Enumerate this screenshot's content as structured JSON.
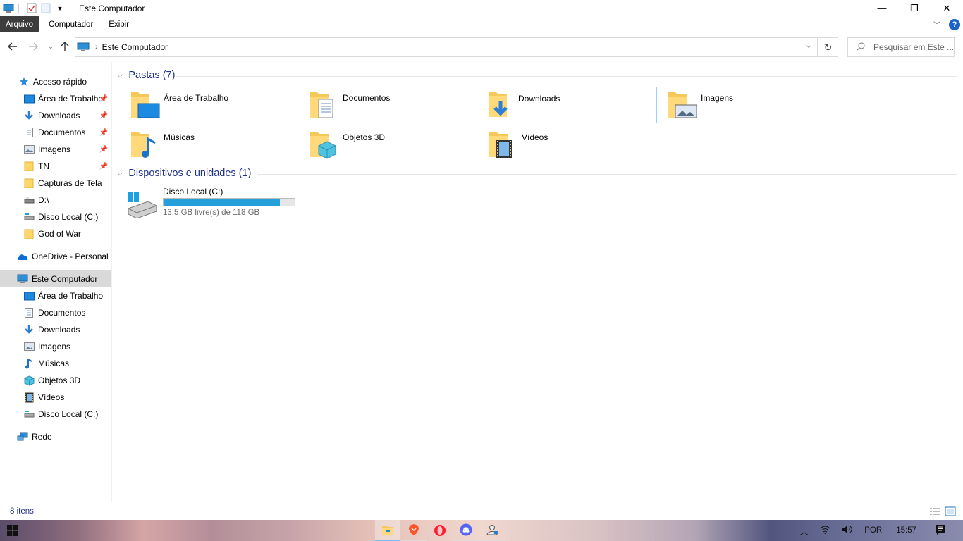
{
  "window": {
    "title": "Este Computador",
    "controls": {
      "minimize": "—",
      "maximize": "❐",
      "close": "✕"
    }
  },
  "ribbon": {
    "tabs": [
      {
        "label": "Arquivo",
        "active": true
      },
      {
        "label": "Computador",
        "active": false
      },
      {
        "label": "Exibir",
        "active": false
      }
    ],
    "help": "?"
  },
  "address": {
    "path": "Este Computador",
    "search_placeholder": "Pesquisar em Este ..."
  },
  "sidebar": {
    "quick_access": "Acesso rápido",
    "quick_items": [
      {
        "label": "Área de Trabalho",
        "icon": "desktop-icon",
        "pinned": true
      },
      {
        "label": "Downloads",
        "icon": "downloads-icon",
        "pinned": true
      },
      {
        "label": "Documentos",
        "icon": "documents-icon",
        "pinned": true
      },
      {
        "label": "Imagens",
        "icon": "pictures-icon",
        "pinned": true
      },
      {
        "label": "TN",
        "icon": "folder-icon",
        "pinned": true
      },
      {
        "label": "Capturas de Tela",
        "icon": "folder-icon",
        "pinned": false
      },
      {
        "label": "D:\\",
        "icon": "drive-icon",
        "pinned": false
      },
      {
        "label": "Disco Local (C:)",
        "icon": "local-disk-icon",
        "pinned": false
      },
      {
        "label": "God of War",
        "icon": "folder-icon",
        "pinned": false
      }
    ],
    "onedrive": "OneDrive - Personal",
    "this_pc": "Este Computador",
    "pc_items": [
      {
        "label": "Área de Trabalho",
        "icon": "desktop-icon"
      },
      {
        "label": "Documentos",
        "icon": "documents-icon"
      },
      {
        "label": "Downloads",
        "icon": "downloads-icon"
      },
      {
        "label": "Imagens",
        "icon": "pictures-icon"
      },
      {
        "label": "Músicas",
        "icon": "music-icon"
      },
      {
        "label": "Objetos 3D",
        "icon": "objects3d-icon"
      },
      {
        "label": "Vídeos",
        "icon": "videos-icon"
      },
      {
        "label": "Disco Local (C:)",
        "icon": "local-disk-icon"
      }
    ],
    "network": "Rede"
  },
  "main": {
    "folders_header": "Pastas (7)",
    "folders": [
      {
        "label": "Área de Trabalho",
        "icon": "desktop-folder-icon",
        "selected": false
      },
      {
        "label": "Documentos",
        "icon": "documents-folder-icon",
        "selected": false
      },
      {
        "label": "Downloads",
        "icon": "downloads-folder-icon",
        "selected": true
      },
      {
        "label": "Imagens",
        "icon": "pictures-folder-icon",
        "selected": false
      },
      {
        "label": "Músicas",
        "icon": "music-folder-icon",
        "selected": false
      },
      {
        "label": "Objetos 3D",
        "icon": "objects3d-folder-icon",
        "selected": false
      },
      {
        "label": "Vídeos",
        "icon": "videos-folder-icon",
        "selected": false
      }
    ],
    "devices_header": "Dispositivos e unidades (1)",
    "drive": {
      "name": "Disco Local (C:)",
      "free_text": "13,5 GB livre(s) de 118 GB",
      "used_fraction": 0.886
    }
  },
  "status": {
    "count": "8 itens"
  },
  "taskbar": {
    "apps": [
      "file-explorer-icon",
      "brave-icon",
      "opera-icon",
      "discord-icon",
      "user-app-icon"
    ],
    "language": "POR",
    "time": "15:57"
  },
  "colors": {
    "accent": "#1e3287",
    "selection_border": "#99d1ff",
    "drive_bar": "#26a0da",
    "help": "#1a64c8"
  }
}
